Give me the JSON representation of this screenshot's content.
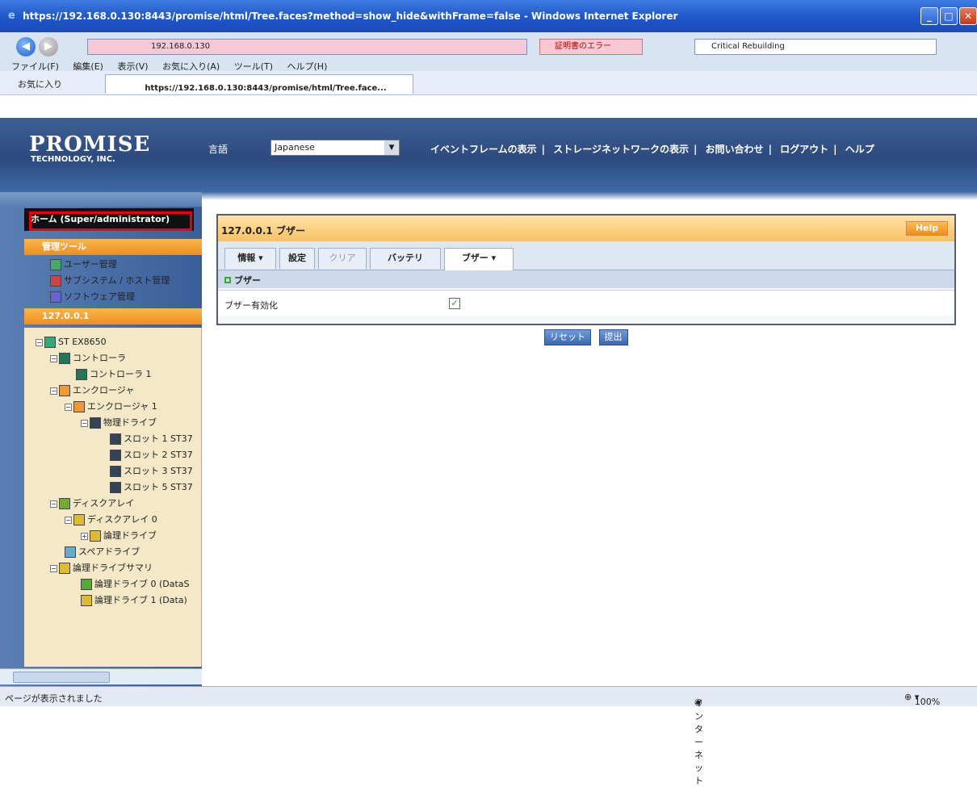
{
  "window": {
    "title": "https://192.168.0.130:8443/promise/html/Tree.faces?method=show_hide&withFrame=false - Windows Internet Explorer",
    "address": "192.168.0.130",
    "cert_error": "証明書のエラー",
    "search_value": "Critical Rebuilding",
    "menu": [
      "ファイル(F)",
      "編集(E)",
      "表示(V)",
      "お気に入り(A)",
      "ツール(T)",
      "ヘルプ(H)"
    ],
    "favorites_label": "お気に入り",
    "tab_title": "https://192.168.0.130:8443/promise/html/Tree.face..."
  },
  "header": {
    "logo": "PROMISE",
    "logo_sub": "TECHNOLOGY, INC.",
    "lang_label": "言語",
    "lang_value": "Japanese",
    "links": [
      "イベントフレームの表示",
      "ストレージネットワークの表示",
      "お問い合わせ",
      "ログアウト",
      "ヘルプ"
    ]
  },
  "sidebar": {
    "home": "ホーム (Super/administrator)",
    "admin_tools": "管理ツール",
    "admin_items": [
      "ユーザー管理",
      "サブシステム / ホスト管理",
      "ソフトウェア管理"
    ],
    "host": "127.0.0.1",
    "tree": [
      {
        "label": "ST EX8650"
      },
      {
        "label": "コントローラ"
      },
      {
        "label": "コントローラ 1"
      },
      {
        "label": "エンクロージャ"
      },
      {
        "label": "エンクロージャ 1"
      },
      {
        "label": "物理ドライブ"
      },
      {
        "label": "スロット 1 ST37"
      },
      {
        "label": "スロット 2 ST37"
      },
      {
        "label": "スロット 3 ST37"
      },
      {
        "label": "スロット 5 ST37"
      },
      {
        "label": "ディスクアレイ"
      },
      {
        "label": "ディスクアレイ 0"
      },
      {
        "label": "論理ドライブ"
      },
      {
        "label": "スペアドライブ"
      },
      {
        "label": "論理ドライブサマリ"
      },
      {
        "label": "論理ドライブ 0 (DataS"
      },
      {
        "label": "論理ドライブ 1 (Data)"
      }
    ]
  },
  "panel": {
    "title": "127.0.0.1 ブザー",
    "help": "Help",
    "tabs": [
      "情報",
      "設定",
      "クリア",
      "バッテリ",
      "ブザー"
    ],
    "section": "ブザー",
    "row_label": "ブザー有効化",
    "checkbox_checked": "✓",
    "reset": "リセット",
    "submit": "提出"
  },
  "status": {
    "text": "ページが表示されました",
    "zone": "インターネット",
    "zoom": "100%"
  }
}
